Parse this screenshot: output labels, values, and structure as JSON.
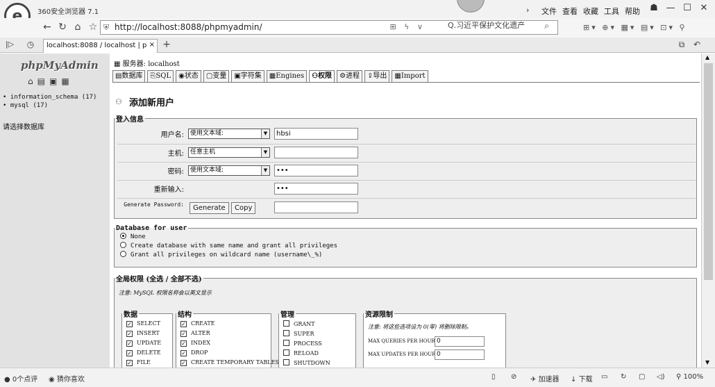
{
  "browser": {
    "app_title": "360安全浏览器 7.1",
    "menu": [
      "文件",
      "查看",
      "收藏",
      "工具",
      "帮助"
    ],
    "url": "http://localhost:8088/phpmyadmin/",
    "search_placeholder": "Q.习近平保护文化遗产",
    "tab_title": "localhost:8088 / localhost | p",
    "tab_close": "×",
    "new_tab": "+"
  },
  "sidebar": {
    "logo": "phpMyAdmin",
    "databases": [
      "information_schema (17)",
      "mysql (17)"
    ],
    "choose_db": "请选择数据库"
  },
  "header": {
    "server_label": "服务器: localhost",
    "tabs": [
      "数据库",
      "SQL",
      "状态",
      "变量",
      "字符集",
      "Engines",
      "权限",
      "进程",
      "导出",
      "Import"
    ],
    "active_tab": 6
  },
  "page_title": "添加新用户",
  "login_info": {
    "legend": "登入信息",
    "username_label": "用户名:",
    "username_select": "使用文本域:",
    "username_value": "hbsi",
    "host_label": "主机:",
    "host_select": "任意主机",
    "password_label": "密码:",
    "password_select": "使用文本域:",
    "password_value": "•••",
    "retype_label": "重新输入:",
    "retype_value": "•••",
    "generate_label": "Generate Password:",
    "generate_button": "Generate",
    "copy_button": "Copy"
  },
  "database_for_user": {
    "legend": "Database for user",
    "options": [
      "None",
      "Create database with same name and grant all privileges",
      "Grant all privileges on wildcard name (username\\_%)"
    ],
    "selected": 0
  },
  "global_privileges": {
    "legend": "全局权限 (全选 / 全部不选)",
    "note": "注意: MySQL 权限名称会以英文显示",
    "data": {
      "legend": "数据",
      "items": [
        "SELECT",
        "INSERT",
        "UPDATE",
        "DELETE",
        "FILE"
      ],
      "checked": [
        true,
        true,
        true,
        true,
        true
      ]
    },
    "structure": {
      "legend": "结构",
      "items": [
        "CREATE",
        "ALTER",
        "INDEX",
        "DROP",
        "CREATE TEMPORARY TABLES"
      ],
      "checked": [
        true,
        true,
        true,
        true,
        true
      ]
    },
    "admin": {
      "legend": "管理",
      "items": [
        "GRANT",
        "SUPER",
        "PROCESS",
        "RELOAD",
        "SHUTDOWN"
      ],
      "checked": [
        false,
        false,
        false,
        false,
        false
      ]
    },
    "resource": {
      "legend": "资源限制",
      "note": "注意: 将这些选项设为 0(零) 将删除限制。",
      "rows": [
        {
          "label": "MAX QUERIES PER HOUR",
          "value": "0"
        },
        {
          "label": "MAX UPDATES PER HOUR",
          "value": "0"
        }
      ]
    }
  },
  "status": {
    "left1": "0个点评",
    "left2": "猜你喜欢",
    "accelerator": "加速器",
    "download": "下载",
    "zoom": "100%"
  }
}
